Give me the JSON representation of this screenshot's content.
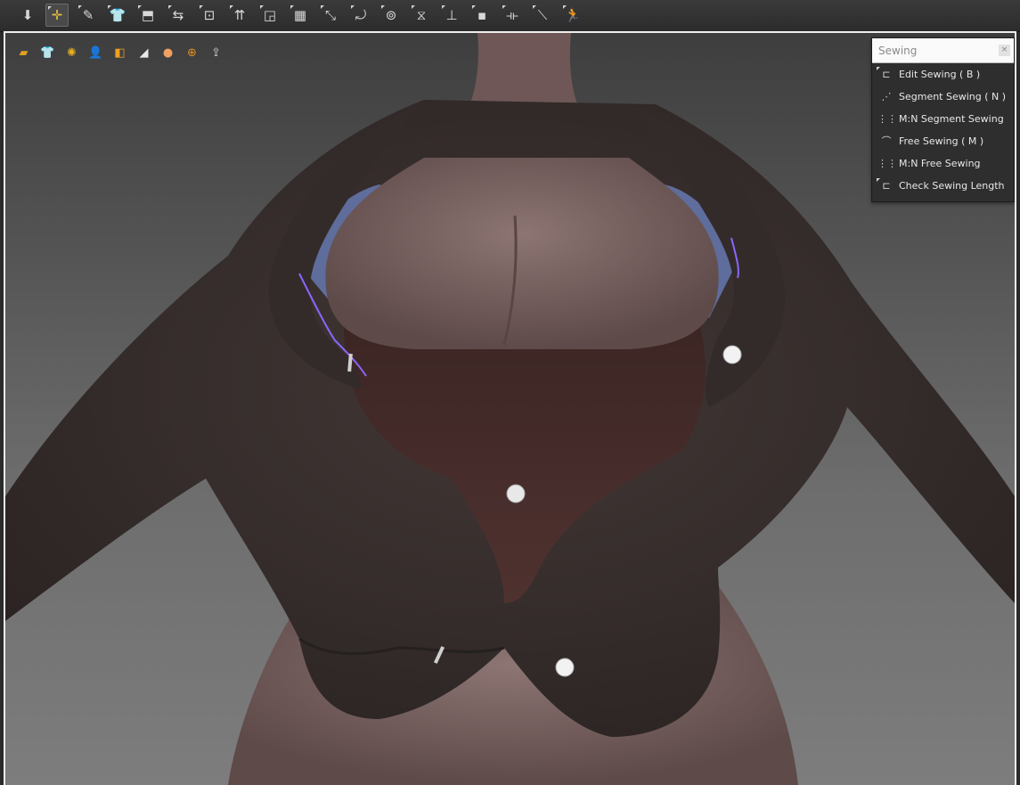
{
  "toolbar": {
    "tools": [
      {
        "name": "move-down-icon",
        "glyph": "⬇"
      },
      {
        "name": "transform-icon",
        "glyph": "✛"
      },
      {
        "name": "edit-pattern-icon",
        "glyph": "✎"
      },
      {
        "name": "garment-icon",
        "glyph": "👕"
      },
      {
        "name": "arrange-icon",
        "glyph": "⬒"
      },
      {
        "name": "fold-icon",
        "glyph": "⇆"
      },
      {
        "name": "point-icon",
        "glyph": "⊡"
      },
      {
        "name": "avatar-icon",
        "glyph": "⇈"
      },
      {
        "name": "trim-icon",
        "glyph": "◲"
      },
      {
        "name": "grid-icon",
        "glyph": "▦"
      },
      {
        "name": "segment-icon",
        "glyph": "⤡"
      },
      {
        "name": "sew-icon",
        "glyph": "⤾"
      },
      {
        "name": "button-icon",
        "glyph": "⊚"
      },
      {
        "name": "zipper-icon",
        "glyph": "⧖"
      },
      {
        "name": "tack-icon",
        "glyph": "⊥"
      },
      {
        "name": "pin-icon",
        "glyph": "▪"
      },
      {
        "name": "measure-icon",
        "glyph": "⟛"
      },
      {
        "name": "tape-icon",
        "glyph": "⟍"
      },
      {
        "name": "simulate-icon",
        "glyph": "🏃"
      }
    ]
  },
  "viewport": {
    "tools": [
      {
        "name": "fabric-icon",
        "glyph": "▰",
        "color": "#e0a020"
      },
      {
        "name": "clothing-icon",
        "glyph": "👕",
        "color": "#cfcfcf"
      },
      {
        "name": "particles-icon",
        "glyph": "✺",
        "color": "#e8b020"
      },
      {
        "name": "avatar-user-icon",
        "glyph": "👤",
        "color": "#e0e0e0"
      },
      {
        "name": "layers-icon",
        "glyph": "◧",
        "color": "#f0a020"
      },
      {
        "name": "flat-icon",
        "glyph": "◢",
        "color": "#e8e8e8"
      },
      {
        "name": "head-icon",
        "glyph": "●",
        "color": "#f0a060"
      },
      {
        "name": "globe-icon",
        "glyph": "⊕",
        "color": "#e09020"
      },
      {
        "name": "export-icon",
        "glyph": "⇪",
        "color": "#d0d0d0"
      }
    ]
  },
  "colors": {
    "skin": "#7f6866",
    "jacket": "#393130",
    "blouse": "#4a2f2c",
    "bra": "#5f6d9c",
    "seam": "#8a66ff",
    "button": "#f2f2f2",
    "panel_header": "#fafafa",
    "panel_bg": "#2e2e2e"
  },
  "sewing_panel": {
    "title": "Sewing",
    "close_glyph": "×",
    "items": [
      {
        "label": "Edit Sewing ( B )",
        "glyph": "⊏",
        "name": "edit-sewing-icon",
        "tri": true
      },
      {
        "label": "Segment Sewing ( N )",
        "glyph": "⋰",
        "name": "segment-sewing-icon",
        "tri": false
      },
      {
        "label": "M:N Segment Sewing",
        "glyph": "⋮⋮",
        "name": "mn-segment-sewing-icon",
        "tri": false
      },
      {
        "label": "Free Sewing ( M )",
        "glyph": "⌒",
        "name": "free-sewing-icon",
        "tri": false
      },
      {
        "label": "M:N Free Sewing",
        "glyph": "⋮⋮",
        "name": "mn-free-sewing-icon",
        "tri": false
      },
      {
        "label": "Check Sewing Length",
        "glyph": "⊏",
        "name": "check-sewing-length-icon",
        "tri": true
      }
    ]
  }
}
